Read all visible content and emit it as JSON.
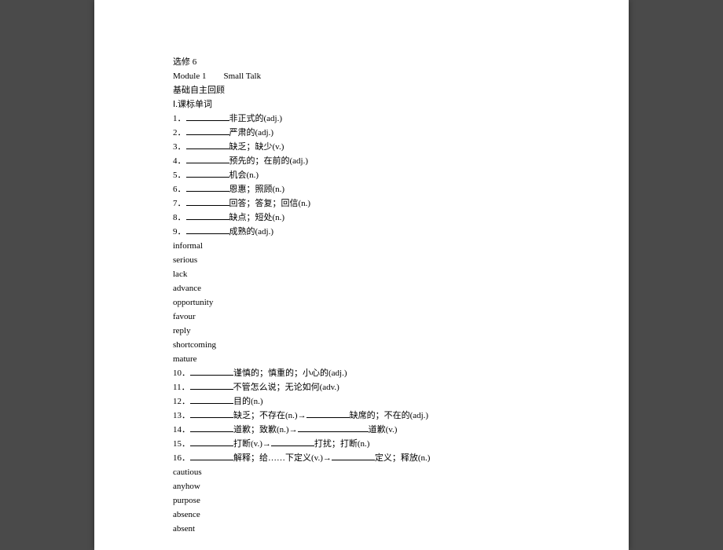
{
  "header": {
    "book": "选修 6",
    "module": "Module 1",
    "title": "Small Talk",
    "section": "基础自主回顾",
    "subsection": "Ⅰ.课标单词"
  },
  "items1": [
    {
      "num": "1．",
      "def": "非正式的(adj.)"
    },
    {
      "num": "2．",
      "def": "严肃的(adj.)"
    },
    {
      "num": "3．",
      "def": "缺乏；缺少(v.)"
    },
    {
      "num": "4．",
      "def": "预先的；在前的(adj.)"
    },
    {
      "num": "5．",
      "def": "机会(n.)"
    },
    {
      "num": "6．",
      "def": "恩惠；照顾(n.)"
    },
    {
      "num": "7．",
      "def": "回答；答复；回信(n.)"
    },
    {
      "num": "8．",
      "def": "缺点；短处(n.)"
    },
    {
      "num": "9．",
      "def": "成熟的(adj.)"
    }
  ],
  "answers1": [
    "informal",
    "serious",
    "lack",
    "advance",
    "opportunity",
    "favour",
    "reply",
    "shortcoming",
    "mature"
  ],
  "items2": [
    {
      "num": "10．",
      "def": "谨慎的；慎重的；小心的(adj.)"
    },
    {
      "num": "11．",
      "def": "不管怎么说；无论如何(adv.)"
    },
    {
      "num": "12．",
      "def": "目的(n.)"
    }
  ],
  "items3": [
    {
      "num": "13．",
      "def1": "缺乏；不存在(n.)→",
      "def2": "缺席的；不在的(adj.)"
    },
    {
      "num": "14．",
      "def1": "道歉；致歉(n.)→",
      "def2": "道歉(v.)"
    },
    {
      "num": "15．",
      "def1": "打断(v.)→",
      "def2": "打扰；打断(n.)"
    },
    {
      "num": "16．",
      "def1": "解释；给……下定义(v.)→",
      "def2": "定义；释放(n.)"
    }
  ],
  "answers2": [
    "cautious",
    "anyhow",
    "purpose",
    "absence",
    "absent"
  ]
}
